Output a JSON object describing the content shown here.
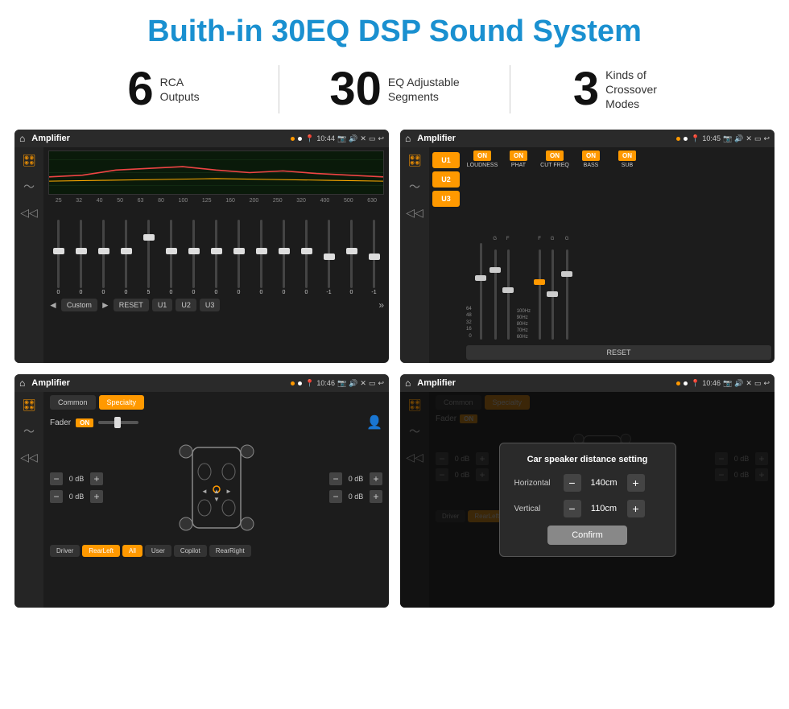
{
  "header": {
    "title": "Buith-in 30EQ DSP Sound System"
  },
  "stats": [
    {
      "number": "6",
      "text_line1": "RCA",
      "text_line2": "Outputs"
    },
    {
      "number": "30",
      "text_line1": "EQ Adjustable",
      "text_line2": "Segments"
    },
    {
      "number": "3",
      "text_line1": "Kinds of",
      "text_line2": "Crossover Modes"
    }
  ],
  "screens": [
    {
      "id": "screen1",
      "status_bar": {
        "title": "Amplifier",
        "time": "10:44"
      },
      "type": "eq"
    },
    {
      "id": "screen2",
      "status_bar": {
        "title": "Amplifier",
        "time": "10:45"
      },
      "type": "amp"
    },
    {
      "id": "screen3",
      "status_bar": {
        "title": "Amplifier",
        "time": "10:46"
      },
      "type": "fader"
    },
    {
      "id": "screen4",
      "status_bar": {
        "title": "Amplifier",
        "time": "10:46"
      },
      "type": "distance"
    }
  ],
  "eq_sliders": {
    "freq_labels": [
      "25",
      "32",
      "40",
      "50",
      "63",
      "80",
      "100",
      "125",
      "160",
      "200",
      "250",
      "320",
      "400",
      "500",
      "630"
    ],
    "values": [
      "0",
      "0",
      "0",
      "0",
      "5",
      "0",
      "0",
      "0",
      "0",
      "0",
      "0",
      "0",
      "-1",
      "0",
      "-1"
    ],
    "thumb_positions": [
      50,
      50,
      50,
      50,
      25,
      50,
      50,
      50,
      50,
      50,
      50,
      50,
      60,
      50,
      60
    ],
    "preset_label": "Custom",
    "buttons": [
      "RESET",
      "U1",
      "U2",
      "U3"
    ]
  },
  "amp_settings": {
    "presets": [
      "U1",
      "U2",
      "U3"
    ],
    "toggles": [
      {
        "label": "LOUDNESS",
        "state": "ON"
      },
      {
        "label": "PHAT",
        "state": "ON"
      },
      {
        "label": "CUT FREQ",
        "state": "ON"
      },
      {
        "label": "BASS",
        "state": "ON"
      },
      {
        "label": "SUB",
        "state": "ON"
      }
    ],
    "reset_label": "RESET"
  },
  "fader_settings": {
    "tabs": [
      "Common",
      "Specialty"
    ],
    "active_tab": "Specialty",
    "fader_label": "Fader",
    "fader_on": "ON",
    "db_labels": [
      "0 dB",
      "0 dB",
      "0 dB",
      "0 dB"
    ],
    "buttons": [
      "Driver",
      "Copilot",
      "RearLeft",
      "All",
      "User",
      "RearRight"
    ],
    "nav_directions": [
      "◄",
      "◄",
      "►",
      "►"
    ]
  },
  "distance_dialog": {
    "title": "Car speaker distance setting",
    "rows": [
      {
        "label": "Horizontal",
        "value": "140cm"
      },
      {
        "label": "Vertical",
        "value": "110cm"
      }
    ],
    "confirm_label": "Confirm"
  }
}
